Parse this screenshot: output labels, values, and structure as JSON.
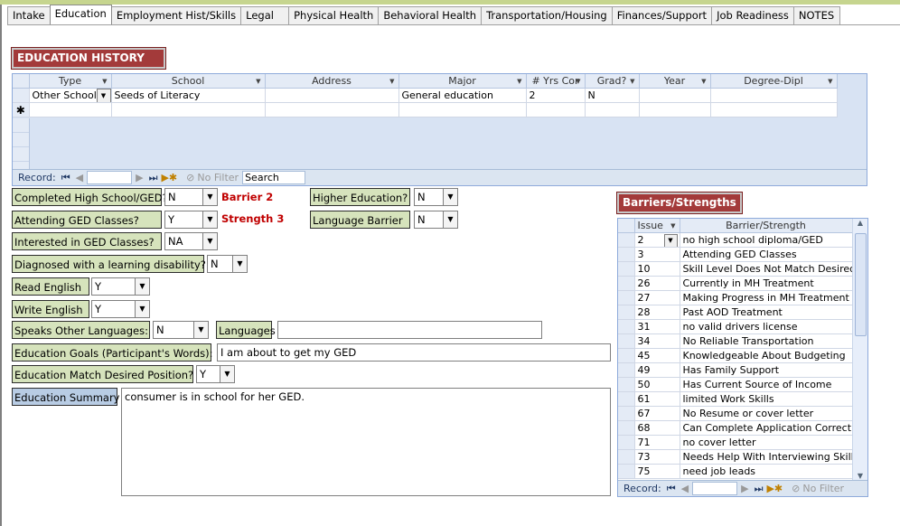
{
  "tabs": [
    "Intake",
    "Education",
    "Employment Hist/Skills",
    "Legal",
    "Physical Health",
    "Behavioral Health",
    "Transportation/Housing",
    "Finances/Support",
    "Job Readiness",
    "NOTES"
  ],
  "section_title": "EDUCATION HISTORY",
  "edu_grid": {
    "columns": [
      "Type",
      "School",
      "Address",
      "Major",
      "# Yrs Cor",
      "Grad?",
      "Year",
      "Degree-Dipl"
    ],
    "row": {
      "type": "Other School",
      "school": "Seeds of Literacy",
      "address": "",
      "major": "General education",
      "yrs": "2",
      "grad": "N",
      "year": "",
      "degree": ""
    },
    "new_row_marker": "✱",
    "nav": {
      "record_label": "Record:",
      "no_filter": "No Filter",
      "search": "Search"
    }
  },
  "form": {
    "completed_hs": {
      "label": "Completed High School/GED?",
      "value": "N"
    },
    "barrier_tag": "Barrier 2",
    "higher_ed": {
      "label": "Higher Education?",
      "value": "N"
    },
    "attending_ged": {
      "label": "Attending GED Classes?",
      "value": "Y"
    },
    "strength_tag": "Strength 3",
    "language_barrier": {
      "label": "Language Barrier",
      "value": "N"
    },
    "interested_ged": {
      "label": "Interested in GED Classes?",
      "value": "NA"
    },
    "learning_disability": {
      "label": "Diagnosed with a learning disability?",
      "value": "N"
    },
    "read_english": {
      "label": "Read English",
      "value": "Y"
    },
    "write_english": {
      "label": "Write English",
      "value": "Y"
    },
    "speaks_other": {
      "label": "Speaks Other Languages:",
      "value": "N"
    },
    "languages": {
      "label": "Languages",
      "value": ""
    },
    "edu_goals": {
      "label": "Education Goals (Participant's Words):",
      "value": "I am about to get my GED"
    },
    "edu_match": {
      "label": "Education Match Desired Position?",
      "value": "Y"
    },
    "edu_summary": {
      "label": "Education Summary",
      "value": "consumer is in school for her GED."
    }
  },
  "barriers": {
    "title": "Barriers/Strengths",
    "columns": [
      "Issue",
      "Barrier/Strength"
    ],
    "rows": [
      [
        "2",
        "no high school diploma/GED"
      ],
      [
        "3",
        "Attending GED Classes"
      ],
      [
        "10",
        "Skill Level Does Not Match Desired"
      ],
      [
        "26",
        "Currently in MH Treatment"
      ],
      [
        "27",
        "Making Progress in MH Treatment"
      ],
      [
        "28",
        "Past AOD Treatment"
      ],
      [
        "31",
        "no valid drivers license"
      ],
      [
        "34",
        "No Reliable Transportation"
      ],
      [
        "45",
        "Knowledgeable About Budgeting"
      ],
      [
        "49",
        "Has Family Support"
      ],
      [
        "50",
        "Has Current Source of Income"
      ],
      [
        "61",
        "limited Work Skills"
      ],
      [
        "67",
        "No Resume or cover letter"
      ],
      [
        "68",
        "Can Complete Application Correctly"
      ],
      [
        "71",
        "no cover letter"
      ],
      [
        "73",
        "Needs Help With Interviewing Skills"
      ],
      [
        "75",
        "need job leads"
      ]
    ],
    "nav": {
      "record_label": "Record:",
      "no_filter": "No Filter"
    }
  }
}
